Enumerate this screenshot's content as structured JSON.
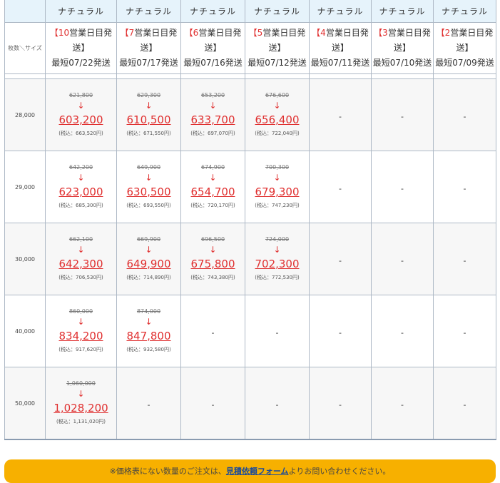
{
  "table": {
    "corner_label": "",
    "size_label": "枚数＼サイズ",
    "columns": [
      {
        "header": "ナチュラル",
        "days_bracket_open": "【",
        "days_num": "10",
        "days_text": "営業日目発送】",
        "earliest": "最短07/22発送"
      },
      {
        "header": "ナチュラル",
        "days_bracket_open": "【",
        "days_num": "7",
        "days_text": "営業日目発送】",
        "earliest": "最短07/17発送"
      },
      {
        "header": "ナチュラル",
        "days_bracket_open": "【",
        "days_num": "6",
        "days_text": "営業日目発送】",
        "earliest": "最短07/16発送"
      },
      {
        "header": "ナチュラル",
        "days_bracket_open": "【",
        "days_num": "5",
        "days_text": "営業日目発送】",
        "earliest": "最短07/12発送"
      },
      {
        "header": "ナチュラル",
        "days_bracket_open": "【",
        "days_num": "4",
        "days_text": "営業日目発送】",
        "earliest": "最短07/11発送"
      },
      {
        "header": "ナチュラル",
        "days_bracket_open": "【",
        "days_num": "3",
        "days_text": "営業日目発送】",
        "earliest": "最短07/10発送"
      },
      {
        "header": "ナチュラル",
        "days_bracket_open": "【",
        "days_num": "2",
        "days_text": "営業日目発送】",
        "earliest": "最短07/09発送"
      }
    ],
    "arrow": "↓",
    "dash": "-",
    "rows": [
      {
        "qty": "28,000",
        "cells": [
          {
            "orig": "621,800",
            "price": "603,200",
            "tax": "(税込：663,520円)"
          },
          {
            "orig": "629,300",
            "price": "610,500",
            "tax": "(税込：671,550円)"
          },
          {
            "orig": "653,200",
            "price": "633,700",
            "tax": "(税込：697,070円)"
          },
          {
            "orig": "676,600",
            "price": "656,400",
            "tax": "(税込：722,040円)"
          }
        ]
      },
      {
        "qty": "29,000",
        "cells": [
          {
            "orig": "642,200",
            "price": "623,000",
            "tax": "(税込：685,300円)"
          },
          {
            "orig": "649,900",
            "price": "630,500",
            "tax": "(税込：693,550円)"
          },
          {
            "orig": "674,900",
            "price": "654,700",
            "tax": "(税込：720,170円)"
          },
          {
            "orig": "700,300",
            "price": "679,300",
            "tax": "(税込：747,230円)"
          }
        ]
      },
      {
        "qty": "30,000",
        "cells": [
          {
            "orig": "662,100",
            "price": "642,300",
            "tax": "(税込：706,530円)"
          },
          {
            "orig": "669,900",
            "price": "649,900",
            "tax": "(税込：714,890円)"
          },
          {
            "orig": "696,500",
            "price": "675,800",
            "tax": "(税込：743,380円)"
          },
          {
            "orig": "724,000",
            "price": "702,300",
            "tax": "(税込：772,530円)"
          }
        ]
      },
      {
        "qty": "40,000",
        "cells": [
          {
            "orig": "860,000",
            "price": "834,200",
            "tax": "(税込：917,620円)"
          },
          {
            "orig": "874,000",
            "price": "847,800",
            "tax": "(税込：932,580円)"
          }
        ]
      },
      {
        "qty": "50,000",
        "cells": [
          {
            "orig": "1,060,000",
            "price": "1,028,200",
            "tax": "(税込：1,131,020円)"
          }
        ]
      }
    ]
  },
  "banner": {
    "prefix": "※価格表にない数量のご注文は、",
    "link": "見積依頼フォーム",
    "suffix": "よりお問い合わせください。"
  },
  "colors": {
    "header_bg": "#e6f3fb",
    "price_red": "#e03030",
    "banner_bg": "#f7b000",
    "link_blue": "#1a4a9a"
  }
}
